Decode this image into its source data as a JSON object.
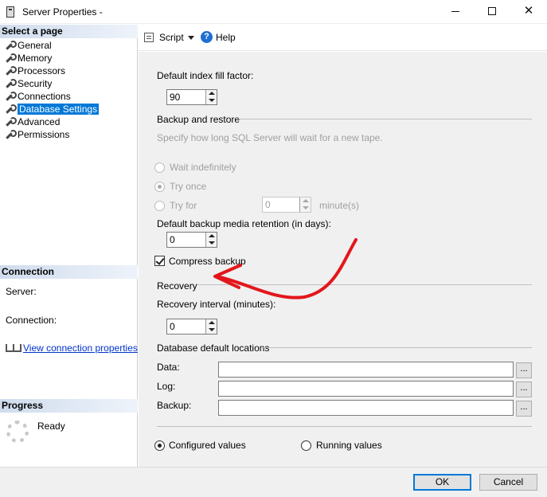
{
  "window": {
    "title": "Server Properties -"
  },
  "left": {
    "select_page_header": "Select a page",
    "pages": [
      {
        "label": "General"
      },
      {
        "label": "Memory"
      },
      {
        "label": "Processors"
      },
      {
        "label": "Security"
      },
      {
        "label": "Connections"
      },
      {
        "label": "Database Settings"
      },
      {
        "label": "Advanced"
      },
      {
        "label": "Permissions"
      }
    ],
    "selected_page": "Database Settings",
    "connection_header": "Connection",
    "server_label": "Server:",
    "connection_label": "Connection:",
    "view_connection_link": "View connection properties",
    "progress_header": "Progress",
    "progress_status": "Ready"
  },
  "toolbar": {
    "script_label": "Script",
    "help_label": "Help"
  },
  "settings": {
    "fill_factor_label": "Default index fill factor:",
    "fill_factor_value": "90",
    "backup_group": "Backup and restore",
    "backup_hint": "Specify how long SQL Server will wait for a new tape.",
    "wait_indefinitely": "Wait indefinitely",
    "try_once": "Try once",
    "try_for": "Try for",
    "try_for_value": "0",
    "minutes_unit": "minute(s)",
    "retention_label": "Default backup media retention (in days):",
    "retention_value": "0",
    "compress_backup": "Compress backup",
    "recovery_group": "Recovery",
    "recovery_interval_label": "Recovery interval (minutes):",
    "recovery_interval_value": "0",
    "locations_group": "Database default locations",
    "data_label": "Data:",
    "log_label": "Log:",
    "backup_label": "Backup:",
    "browse_label": "...",
    "configured_values": "Configured values",
    "running_values": "Running values"
  },
  "footer": {
    "ok_label": "OK",
    "cancel_label": "Cancel"
  },
  "colors": {
    "selection": "#0078d7",
    "annotation_arrow": "#e3161b",
    "link": "#0033cc"
  }
}
